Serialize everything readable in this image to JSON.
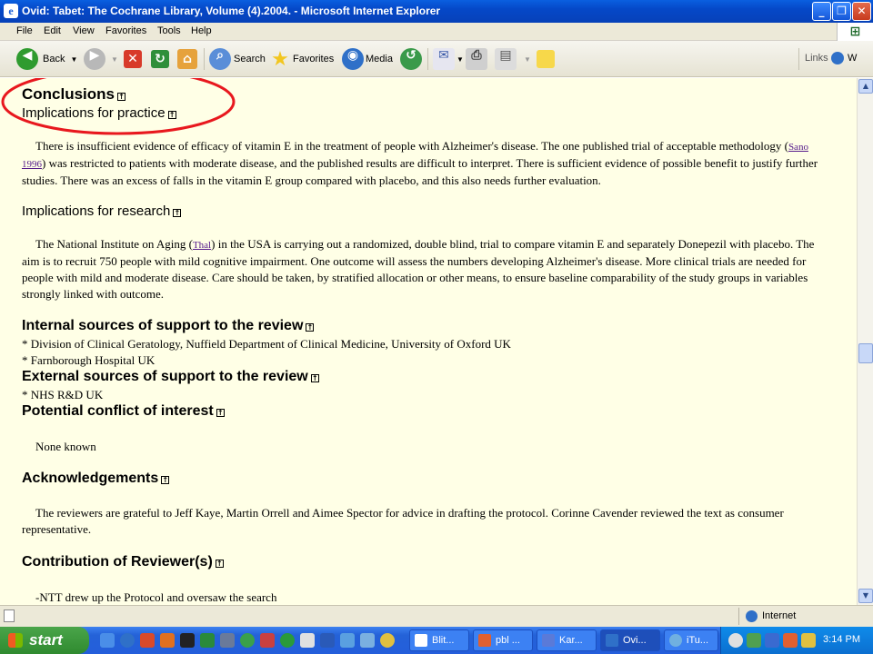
{
  "window": {
    "title": "Ovid: Tabet: The Cochrane Library, Volume (4).2004. - Microsoft Internet Explorer"
  },
  "menu": [
    "File",
    "Edit",
    "View",
    "Favorites",
    "Tools",
    "Help"
  ],
  "toolbar": {
    "back": "Back",
    "search": "Search",
    "favorites": "Favorites",
    "media": "Media",
    "links": "Links"
  },
  "content": {
    "conclusions": "Conclusions",
    "implications_practice": "Implications for practice",
    "practice_p1": "There is insufficient evidence of efficacy of vitamin E in the treatment of people with Alzheimer's disease. The one published trial of acceptable methodology (",
    "practice_link": "Sano 1996",
    "practice_p2": ") was restricted to patients with moderate disease, and the published results are difficult to interpret. There is sufficient evidence of possible benefit to justify further studies. There was an excess of falls in the vitamin E group compared with placebo, and this also needs further evaluation.",
    "implications_research": "Implications for research",
    "research_p1": "The National Institute on Aging (",
    "research_link": "Thal",
    "research_p2": ") in the USA is carrying out a randomized, double blind, trial to compare vitamin E and separately Donepezil with placebo. The aim is to recruit 750 people with mild cognitive impairment. One outcome will assess the numbers developing Alzheimer's disease. More clinical trials are needed for people with mild and moderate disease. Care should be taken, by stratified allocation or other means, to ensure baseline comparability of the study groups in variables strongly linked with outcome.",
    "internal_heading": "Internal sources of support to the review",
    "internal_1": "* Division of Clinical Geratology, Nuffield Department of Clinical Medicine, University of Oxford UK",
    "internal_2": "* Farnborough Hospital UK",
    "external_heading": "External sources of support to the review",
    "external_1": "* NHS R&D UK",
    "conflict_heading": "Potential conflict of interest",
    "conflict_text": "None known",
    "ack_heading": "Acknowledgements",
    "ack_text": "The reviewers are grateful to Jeff Kaye, Martin Orrell and Aimee Spector for advice in drafting the protocol. Corinne Cavender reviewed the text as consumer representative.",
    "contrib_heading": "Contribution of Reviewer(s)",
    "contrib_text": "-NTT drew up the Protocol and oversaw the search"
  },
  "status": {
    "zone": "Internet"
  },
  "taskbar": {
    "start": "start",
    "tasks": [
      "Blit...",
      "pbl ...",
      "Kar...",
      "Ovi...",
      "iTu..."
    ],
    "clock": "3:14 PM"
  },
  "colors": {
    "content_bg": "#ffffe6",
    "annotation": "#e8181e",
    "link": "#551a8b"
  }
}
